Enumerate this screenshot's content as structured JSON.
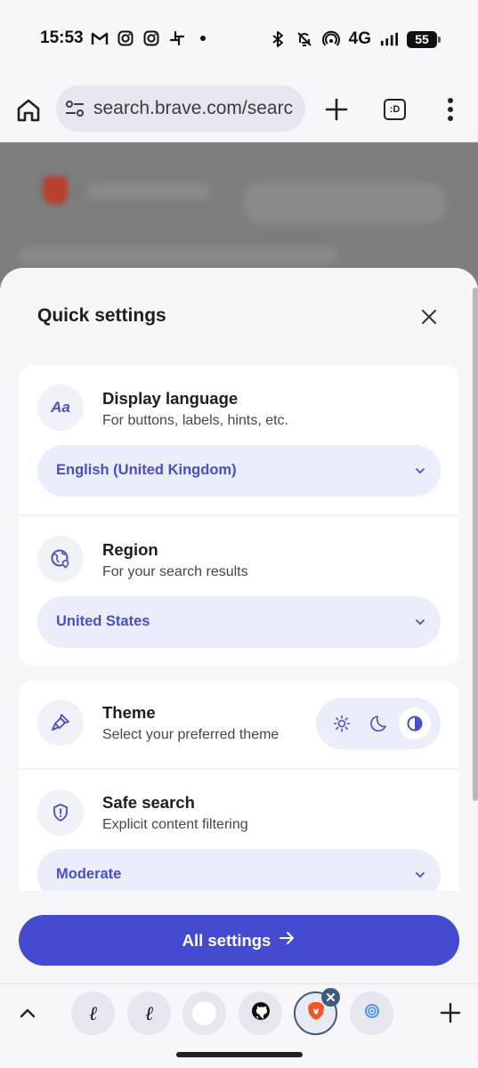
{
  "status_bar": {
    "time": "15:53",
    "left_icons": [
      "gmail-icon",
      "instagram-icon",
      "instagram-icon",
      "slack-icon",
      "dot-icon"
    ],
    "right_icons": [
      "bluetooth-icon",
      "mute-icon",
      "hotspot-icon"
    ],
    "network": "4G",
    "battery": "55"
  },
  "browser": {
    "url": "search.brave.com/searc",
    "tabs_icon_label": ":D"
  },
  "sheet": {
    "title": "Quick settings",
    "language": {
      "title": "Display language",
      "subtitle": "For buttons, labels, hints, etc.",
      "icon_text": "Aa",
      "value": "English (United Kingdom)"
    },
    "region": {
      "title": "Region",
      "subtitle": "For your search results",
      "value": "United States"
    },
    "theme": {
      "title": "Theme",
      "subtitle": "Select your preferred theme",
      "options": [
        "light-icon",
        "dark-icon",
        "system-icon"
      ],
      "selected": "system"
    },
    "safe_search": {
      "title": "Safe search",
      "subtitle": "Explicit content filtering",
      "value": "Moderate"
    },
    "all_settings_label": "All settings"
  },
  "tab_strip": {
    "tabs": [
      {
        "icon": "script-l-icon",
        "glyph": "ℓ"
      },
      {
        "icon": "script-l-icon",
        "glyph": "ℓ"
      },
      {
        "icon": "blank-page-icon",
        "glyph": ""
      },
      {
        "icon": "github-icon",
        "glyph": ""
      },
      {
        "icon": "brave-icon",
        "glyph": "",
        "active": true
      },
      {
        "icon": "spiral-icon",
        "glyph": ""
      }
    ]
  },
  "colors": {
    "accent": "#444bd0",
    "select_text": "#4a4fc4",
    "select_bg": "#eaedfa"
  }
}
